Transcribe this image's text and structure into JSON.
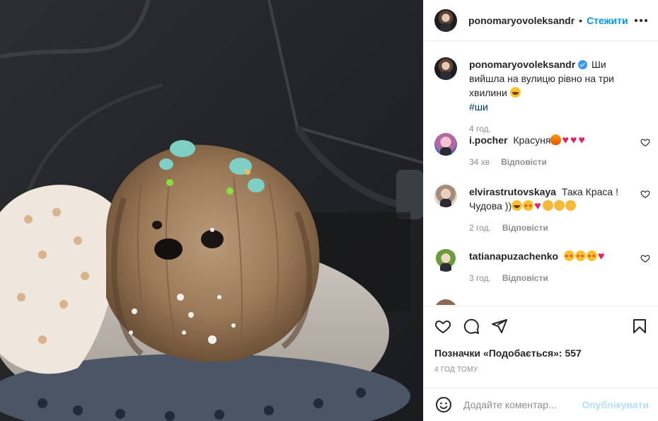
{
  "post": {
    "author": "ponomaryovoleksandr",
    "follow_label": "Стежити",
    "dot": "•",
    "caption": {
      "text": "Ши вийшла на вулицю рівно на три хвилини",
      "hashtag": "#ши",
      "time": "4 год."
    },
    "comments": [
      {
        "user": "i.pocher",
        "text": "Красуня",
        "time": "34 хв",
        "reply": "Відповісти",
        "emoji": [
          "fire",
          "heart",
          "heart",
          "heart"
        ]
      },
      {
        "user": "elvirastrutovskaya",
        "text": "Така Краса ! Чудова ))",
        "time": "2 год.",
        "reply": "Відповісти",
        "emoji": [
          "smile",
          "starstruck",
          "heart",
          "clap",
          "clap",
          "clap"
        ]
      },
      {
        "user": "tatianapuzachenko",
        "text": "",
        "time": "3 год.",
        "reply": "Відповісти",
        "emoji": [
          "starstruck",
          "starstruck",
          "starstruck",
          "heart"
        ]
      }
    ],
    "likes_label": "Позначки «Подобається»: 557",
    "age_label": "4 ГОД ТОМУ",
    "comment_input": {
      "placeholder": "Додайте коментар...",
      "value": ""
    },
    "publish_label": "Опублікувати"
  },
  "icons": {
    "more": "more-horizontal-icon",
    "like": "heart-outline-icon",
    "comment": "comment-bubble-icon",
    "share": "paper-plane-icon",
    "save": "bookmark-icon",
    "emoji": "smiley-icon"
  },
  "colors": {
    "accent": "#0095f6",
    "publish_disabled": "#b2dffc",
    "verified": "#3897f0",
    "heart": "#e0245e"
  }
}
